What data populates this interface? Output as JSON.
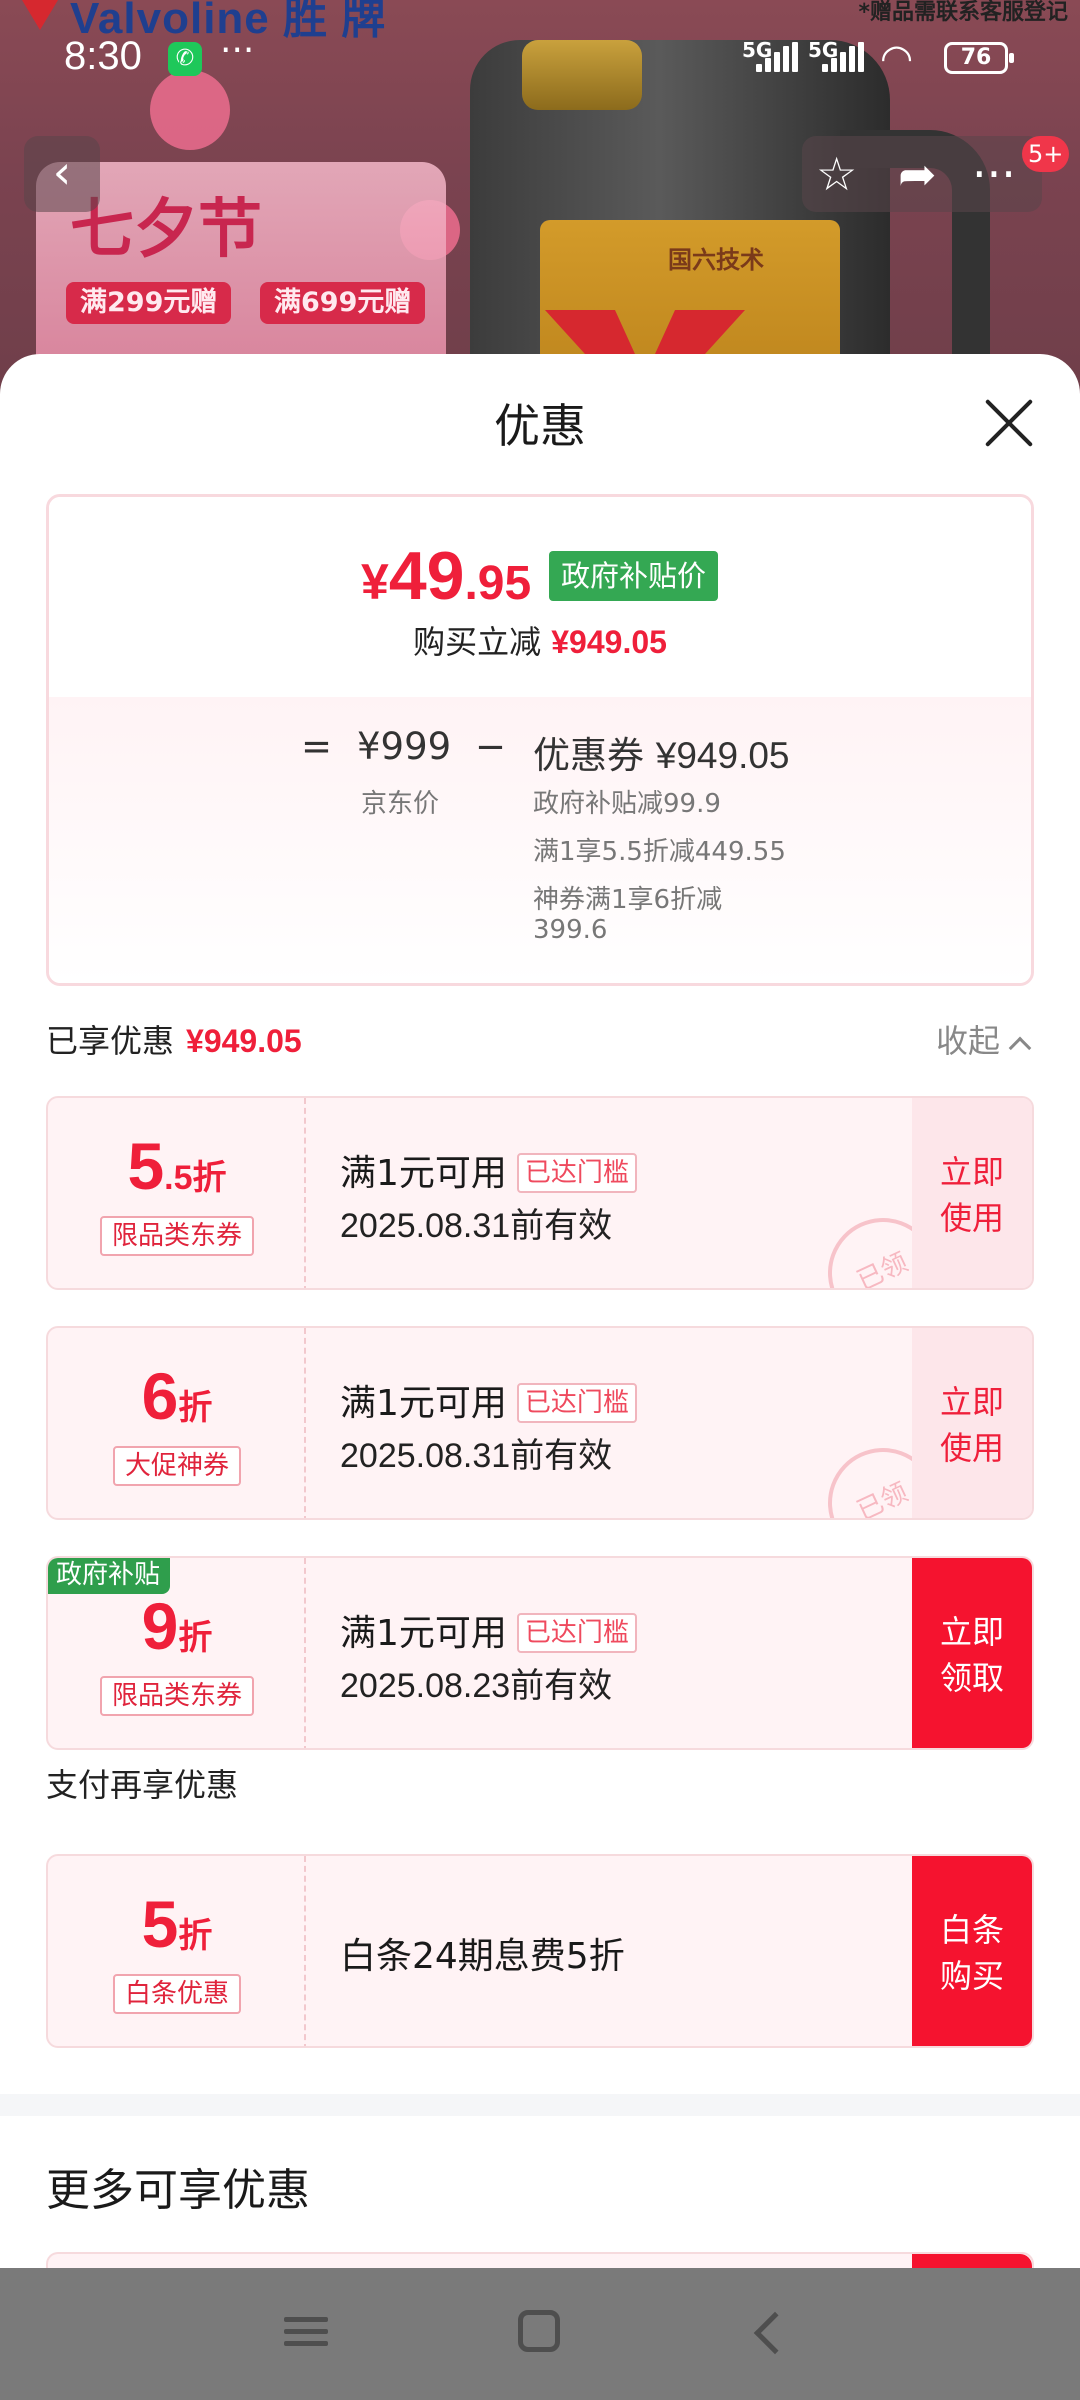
{
  "status_bar": {
    "time": "8:30",
    "more": "···",
    "network1": "5G",
    "network2": "5G",
    "battery": "76"
  },
  "banner": {
    "brand": "Valvoline 胜 牌",
    "gift_note": "*赠品需联系客服登记",
    "festival": "七夕节",
    "chip1": "满299元赠",
    "chip2": "满699元赠",
    "product_text": "国六技术",
    "more_badge": "5+"
  },
  "sheet": {
    "title": "优惠",
    "price_card": {
      "yen": "¥",
      "price_int": "49",
      "price_dec": ".95",
      "gov_tag": "政府补贴价",
      "reduce_label": "购买立减",
      "reduce_amount": "¥949.05",
      "eq": "=",
      "jd_price": "¥999",
      "jd_label": "京东价",
      "minus": "−",
      "coupon_label": "优惠券",
      "coupon_total": "¥949.05",
      "details": [
        "政府补贴减99.9",
        "满1享5.5折减449.55",
        "神券满1享6折减",
        "399.6"
      ]
    },
    "enjoyed_label": "已享优惠",
    "enjoyed_amount": "¥949.05",
    "collapse_label": "收起",
    "coupons": [
      {
        "disc_big": "5",
        "disc_small": ".5折",
        "type": "限品类东券",
        "condition": "满1元可用",
        "threshold": "已达门槛",
        "valid": "2025.08.31前有效",
        "action": "立即使用",
        "stamp": "已领"
      },
      {
        "disc_big": "6",
        "disc_small": "折",
        "type": "大促神券",
        "condition": "满1元可用",
        "threshold": "已达门槛",
        "valid": "2025.08.31前有效",
        "action": "立即使用",
        "stamp": "已领"
      },
      {
        "ribbon": "政府补贴",
        "disc_big": "9",
        "disc_small": "折",
        "type": "限品类东券",
        "condition": "满1元可用",
        "threshold": "已达门槛",
        "valid": "2025.08.23前有效",
        "action": "立即领取"
      }
    ],
    "pay_title": "支付再享优惠",
    "pay_coupon": {
      "disc_big": "5",
      "disc_small": "折",
      "type": "白条优惠",
      "text": "白条24期息费5折",
      "action": "白条购买"
    },
    "more_title": "更多可享优惠"
  },
  "colors": {
    "accent_red": "#ef1f3a",
    "gov_green": "#34a853",
    "coupon_bg": "#fff3f5"
  },
  "icons": [
    "back-icon",
    "star-icon",
    "share-icon",
    "more-icon",
    "close-icon",
    "chevron-up-icon",
    "menu-icon",
    "home-icon",
    "nav-back-icon"
  ]
}
